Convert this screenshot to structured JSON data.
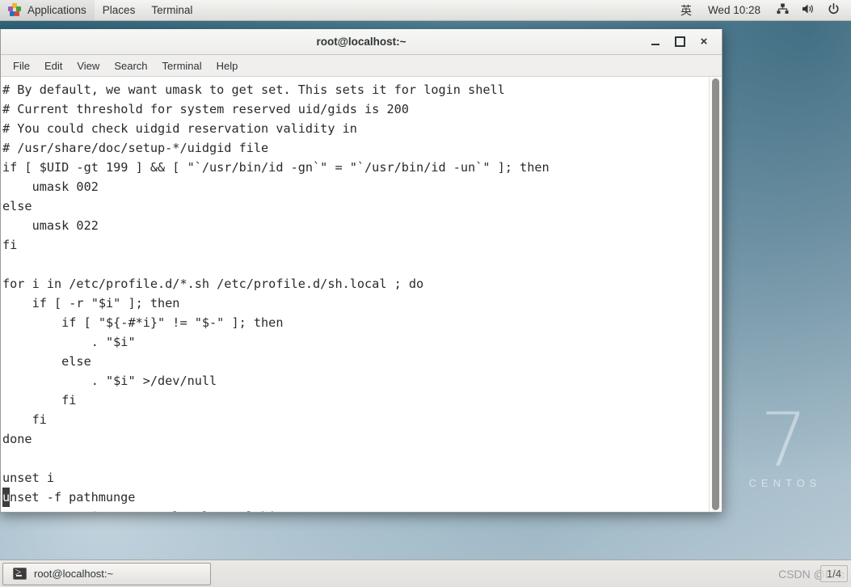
{
  "desktop": {
    "wallpaper_brand_number": "7",
    "wallpaper_brand_name": "CENTOS"
  },
  "top_panel": {
    "applications_label": "Applications",
    "places_label": "Places",
    "terminal_label": "Terminal",
    "apps_icon": "gnome-applications-icon",
    "ime_indicator": "英",
    "clock": "Wed 10:28",
    "network_icon": "network-icon",
    "volume_icon": "volume-icon",
    "power_icon": "power-icon"
  },
  "terminal_window": {
    "title": "root@localhost:~",
    "minimize_label": "minimize",
    "maximize_label": "maximize",
    "close_label": "×",
    "menu": [
      {
        "label": "File"
      },
      {
        "label": "Edit"
      },
      {
        "label": "View"
      },
      {
        "label": "Search"
      },
      {
        "label": "Terminal"
      },
      {
        "label": "Help"
      }
    ],
    "lines": [
      "# By default, we want umask to get set. This sets it for login shell",
      "# Current threshold for system reserved uid/gids is 200",
      "# You could check uidgid reservation validity in",
      "# /usr/share/doc/setup-*/uidgid file",
      "if [ $UID -gt 199 ] && [ \"`/usr/bin/id -gn`\" = \"`/usr/bin/id -un`\" ]; then",
      "    umask 002",
      "else",
      "    umask 022",
      "fi",
      "",
      "for i in /etc/profile.d/*.sh /etc/profile.d/sh.local ; do",
      "    if [ -r \"$i\" ]; then",
      "        if [ \"${-#*i}\" != \"$-\" ]; then",
      "            . \"$i\"",
      "        else",
      "            . \"$i\" >/dev/null",
      "        fi",
      "    fi",
      "done",
      "",
      "unset i"
    ],
    "cursor_line": {
      "cursor_char": "u",
      "rest": "nset -f pathmunge"
    },
    "highlighted_line": "export PATH=$PATH:/usr/local/mysql/bin;",
    "annotation_color": "#ee1c1c",
    "scrollbar": "vertical-scrollbar"
  },
  "bottom_panel": {
    "task_label": "root@localhost:~",
    "task_icon": "terminal-icon",
    "watermark": "CSDN @Eric",
    "workspace_indicator": "1/4"
  }
}
